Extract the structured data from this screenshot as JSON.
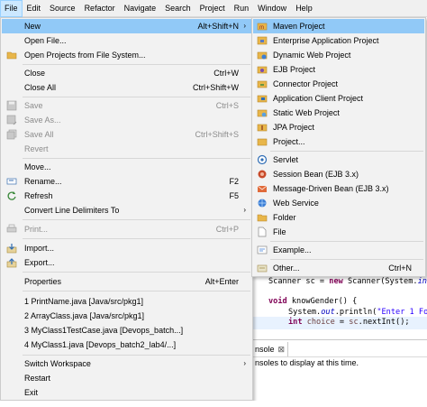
{
  "menubar": {
    "items": [
      "File",
      "Edit",
      "Source",
      "Refactor",
      "Navigate",
      "Search",
      "Project",
      "Run",
      "Window",
      "Help"
    ]
  },
  "file_menu": {
    "new": {
      "label": "New",
      "accel": "Alt+Shift+N",
      "arrow": "›"
    },
    "open_file": {
      "label": "Open File..."
    },
    "open_projects": {
      "label": "Open Projects from File System..."
    },
    "close": {
      "label": "Close",
      "accel": "Ctrl+W"
    },
    "close_all": {
      "label": "Close All",
      "accel": "Ctrl+Shift+W"
    },
    "save": {
      "label": "Save",
      "accel": "Ctrl+S"
    },
    "save_as": {
      "label": "Save As..."
    },
    "save_all": {
      "label": "Save All",
      "accel": "Ctrl+Shift+S"
    },
    "revert": {
      "label": "Revert"
    },
    "move": {
      "label": "Move..."
    },
    "rename": {
      "label": "Rename...",
      "accel": "F2"
    },
    "refresh": {
      "label": "Refresh",
      "accel": "F5"
    },
    "convert": {
      "label": "Convert Line Delimiters To",
      "arrow": "›"
    },
    "print": {
      "label": "Print...",
      "accel": "Ctrl+P"
    },
    "import": {
      "label": "Import..."
    },
    "export": {
      "label": "Export..."
    },
    "properties": {
      "label": "Properties",
      "accel": "Alt+Enter"
    },
    "recent": [
      "1 PrintName.java  [Java/src/pkg1]",
      "2 ArrayClass.java  [Java/src/pkg1]",
      "3 MyClass1TestCase.java  [Devops_batch...]",
      "4 MyClass1.java  [Devops_batch2_lab4/...]"
    ],
    "switch_workspace": {
      "label": "Switch Workspace",
      "arrow": "›"
    },
    "restart": {
      "label": "Restart"
    },
    "exit": {
      "label": "Exit"
    }
  },
  "new_submenu": {
    "items": [
      "Maven Project",
      "Enterprise Application Project",
      "Dynamic Web Project",
      "EJB Project",
      "Connector Project",
      "Application Client Project",
      "Static Web Project",
      "JPA Project",
      "Project...",
      "Servlet",
      "Session Bean (EJB 3.x)",
      "Message-Driven Bean (EJB 3.x)",
      "Web Service",
      "Folder",
      "File",
      "Example...",
      "Other..."
    ],
    "other_accel": "Ctrl+N"
  },
  "editor": {
    "line1_a": "Scanner sc = ",
    "line1_kw": "new",
    "line1_b": " Scanner(System.",
    "line1_c": "in",
    "line2_kw": "void",
    "line2_b": " knowGender() {",
    "line3_a": "System.",
    "line3_fld": "out",
    "line3_b": ".println(",
    "line3_str": "\"Enter 1 Fo",
    "line4_kw": "int",
    "line4_var": " choice",
    "line4_b": " = ",
    "line4_c": "sc",
    "line4_d": ".nextInt();"
  },
  "console": {
    "tab_label": "nsole",
    "tab_close": "⊠",
    "text": "nsoles to display at this time."
  },
  "colors": {
    "highlight": "#91c9f7",
    "menu_bg": "#f2f2f2",
    "menubar_bg": "#f0f0f0"
  }
}
